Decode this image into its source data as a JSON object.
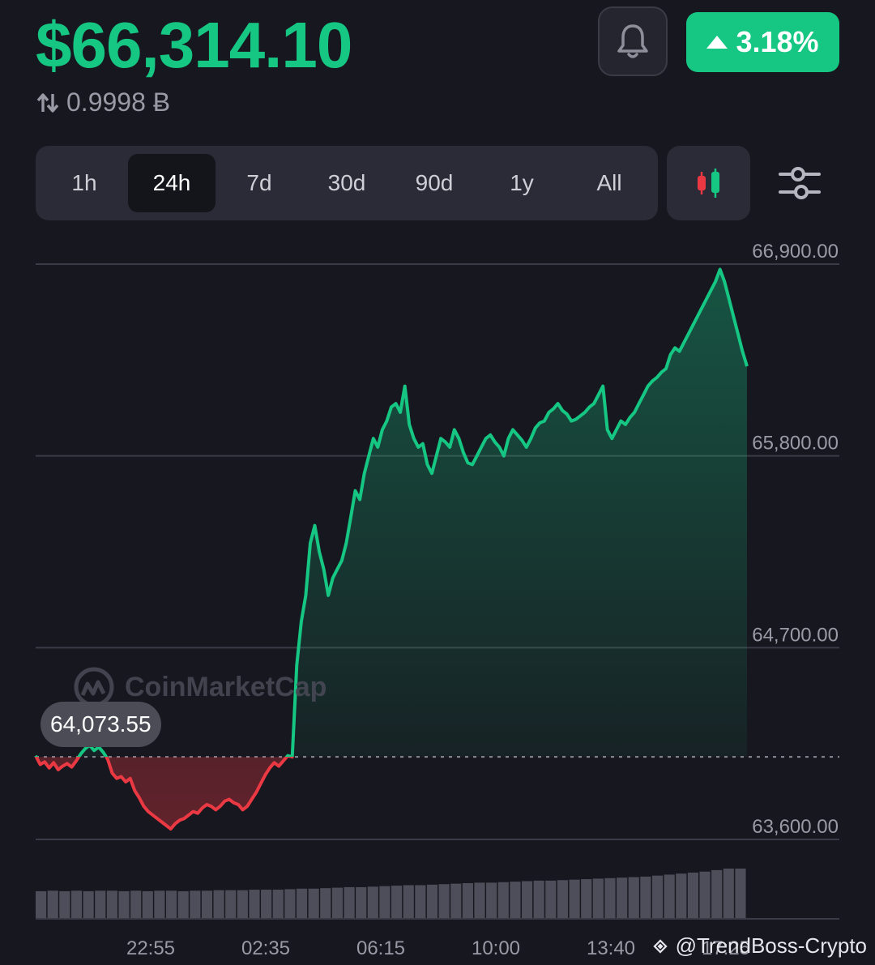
{
  "header": {
    "price": "$66,314.10",
    "btc_value": "0.9998 Ƀ",
    "change": "3.18%",
    "change_direction": "up"
  },
  "icons": {
    "swap": "swap-vertical-icon",
    "bell": "bell-icon",
    "candles": "candlestick-icon",
    "settings": "sliders-icon",
    "watermark": "coinmarketcap-logo-icon",
    "credit": "binance-logo-icon"
  },
  "range_tabs": {
    "items": [
      {
        "label": "1h"
      },
      {
        "label": "24h"
      },
      {
        "label": "7d"
      },
      {
        "label": "30d"
      },
      {
        "label": "90d"
      },
      {
        "label": "1y"
      },
      {
        "label": "All"
      }
    ],
    "active": "24h"
  },
  "watermark_text": "CoinMarketCap",
  "tooltip_value": "64,073.55",
  "credit_text": "@TrendBoss-Crypto",
  "colors": {
    "up": "#16c784",
    "down": "#ea3943",
    "background": "#17171f"
  },
  "chart_data": {
    "type": "line",
    "y_ticks": [
      "66,900.00",
      "65,800.00",
      "64,700.00",
      "63,600.00"
    ],
    "ylim": [
      63600,
      66900
    ],
    "reference_value": 64073.55,
    "x_ticks": [
      "22:55",
      "02:35",
      "06:15",
      "10:00",
      "13:40",
      "17:25"
    ],
    "series": [
      {
        "values": [
          64080,
          64030,
          64045,
          64010,
          64040,
          64000,
          64020,
          64035,
          64015,
          64050,
          64090,
          64120,
          64140,
          64110,
          64130,
          64100,
          64060,
          63980,
          63950,
          63960,
          63930,
          63950,
          63880,
          63840,
          63790,
          63760,
          63740,
          63720,
          63700,
          63680,
          63660,
          63690,
          63710,
          63720,
          63740,
          63760,
          63750,
          63780,
          63800,
          63790,
          63770,
          63790,
          63820,
          63830,
          63810,
          63800,
          63770,
          63790,
          63830,
          63870,
          63920,
          63970,
          64010,
          64040,
          64020,
          64050,
          64080,
          64073,
          64600,
          64850,
          65000,
          65300,
          65400,
          65250,
          65150,
          65000,
          65100,
          65150,
          65200,
          65300,
          65450,
          65600,
          65550,
          65700,
          65800,
          65900,
          65850,
          65950,
          66000,
          66080,
          66100,
          66050,
          66200,
          65980,
          65900,
          65850,
          65870,
          65750,
          65700,
          65800,
          65900,
          65880,
          65850,
          65950,
          65900,
          65820,
          65760,
          65750,
          65800,
          65850,
          65900,
          65920,
          65880,
          65850,
          65800,
          65900,
          65950,
          65920,
          65890,
          65850,
          65900,
          65960,
          65990,
          66000,
          66050,
          66070,
          66100,
          66060,
          66040,
          66000,
          66010,
          66030,
          66050,
          66080,
          66100,
          66150,
          66200,
          65950,
          65900,
          65950,
          66000,
          65980,
          66020,
          66050,
          66100,
          66150,
          66200,
          66230,
          66250,
          66280,
          66300,
          66380,
          66420,
          66400,
          66450,
          66500,
          66550,
          66600,
          66650,
          66700,
          66750,
          66800,
          66870,
          66800,
          66700,
          66600,
          66500,
          66400,
          66314
        ],
        "volume": [
          0.55,
          0.56,
          0.55,
          0.56,
          0.55,
          0.56,
          0.56,
          0.55,
          0.56,
          0.55,
          0.56,
          0.56,
          0.55,
          0.56,
          0.56,
          0.57,
          0.57,
          0.57,
          0.58,
          0.58,
          0.58,
          0.59,
          0.6,
          0.6,
          0.61,
          0.62,
          0.63,
          0.63,
          0.64,
          0.65,
          0.66,
          0.67,
          0.67,
          0.68,
          0.69,
          0.7,
          0.71,
          0.72,
          0.72,
          0.73,
          0.74,
          0.75,
          0.76,
          0.76,
          0.77,
          0.78,
          0.79,
          0.8,
          0.81,
          0.82,
          0.83,
          0.84,
          0.86,
          0.88,
          0.9,
          0.92,
          0.94,
          0.97,
          1.0,
          1.0
        ]
      }
    ],
    "legend": "none",
    "grid": true
  }
}
